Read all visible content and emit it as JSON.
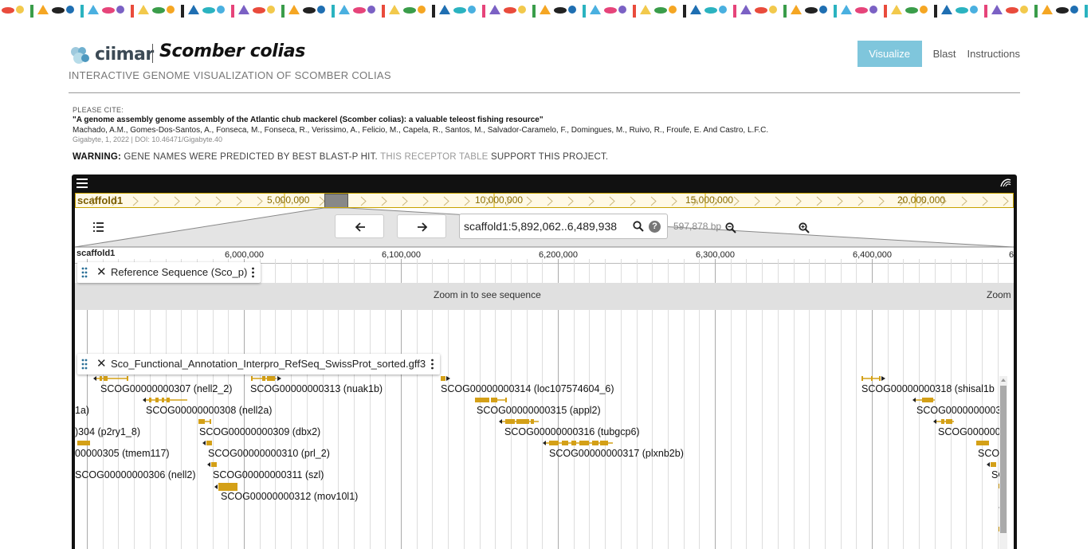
{
  "brand": {
    "logo_text": "ciimar",
    "species": "Scomber colias",
    "subtitle": "INTERACTIVE GENOME VISUALIZATION OF SCOMBER COLIAS"
  },
  "nav": {
    "visualize": "Visualize",
    "blast": "Blast",
    "instructions": "Instructions"
  },
  "citation": {
    "label": "PLEASE CITE:",
    "title": "\"A genome assembly genome assembly of the Atlantic chub mackerel (Scomber colias): a valuable teleost fishing resource\"",
    "authors": "Machado, A.M., Gomes-Dos-Santos, A., Fonseca, M., Fonseca, R., Verissimo, A., Felicio, M., Capela, R., Santos, M., Salvador-Caramelo, F., Domingues, M., Ruivo, R., Froufe, E. And Castro, L.F.C.",
    "journal": "Gigabyte, 1, 2022 | DOI: 10.46471/Gigabyte.40"
  },
  "warning": {
    "bold": "WARNING:",
    "text": " GENE NAMES WERE PREDICTED BY BEST BLAST-P HIT. ",
    "link": "THIS RECEPTOR TABLE",
    "tail": " SUPPORT THIS PROJECT."
  },
  "viewer": {
    "overview": {
      "name": "scaffold1",
      "ticks": [
        "5,000,000",
        "10,000,000",
        "15,000,000",
        "20,000,000"
      ]
    },
    "location": "scaffold1:5,892,062..6,489,938",
    "bp_label": "597,878 bp",
    "ruler": {
      "name": "scaffold1",
      "ticks": [
        "6,000,000",
        "6,100,000",
        "6,200,000",
        "6,300,000",
        "6,400,000",
        "6"
      ]
    },
    "tracks": {
      "reference": {
        "name": "Reference Sequence (Sco_p)",
        "message": "Zoom in to see sequence",
        "message2": "Zoom"
      },
      "annotation": {
        "name": "Sco_Functional_Annotation_Interpro_RefSeq_SwissProt_sorted.gff3"
      }
    },
    "genes": [
      "SCOG00000000307 (nell2_2)",
      "SCOG00000000313 (nuak1b)",
      "SCOG00000000314 (loc107574604_6)",
      "SCOG00000000318 (shisal1b",
      "1a)",
      "SCOG00000000308 (nell2a)",
      "SCOG00000000315 (appl2)",
      "SCOG00000000031",
      ")304 (p2ry1_8)",
      "SCOG00000000309 (dbx2)",
      "SCOG00000000316 (tubgcp6)",
      "SCOG0000000",
      "00000305 (tmem117)",
      "SCOG00000000310 (prl_2)",
      "SCOG00000000317 (plxnb2b)",
      "SCO",
      "SCOG00000000306 (nell2)",
      "SCOG00000000311 (szl)",
      "SC",
      "SCOG00000000312 (mov10l1)"
    ],
    "feature_color": "#d4a017"
  }
}
